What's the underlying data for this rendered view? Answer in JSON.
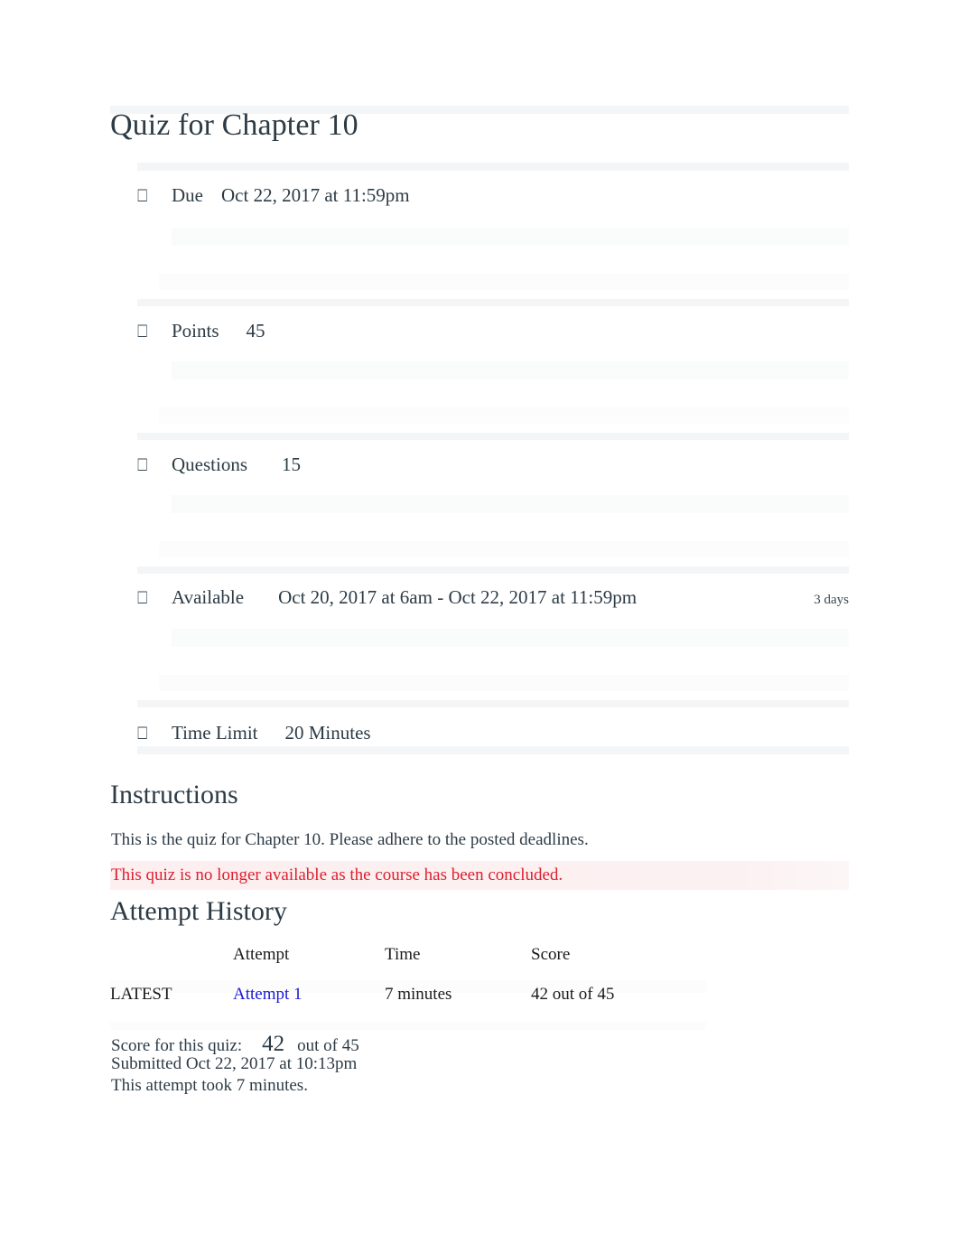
{
  "document": {
    "title": "Quiz for Chapter 10"
  },
  "meta": {
    "bullet_glyph": "⎕",
    "rows": [
      {
        "label": "Due",
        "value": "Oct 22, 2017 at 11:59pm",
        "trailing": ""
      },
      {
        "label": "Points",
        "value": "45",
        "trailing": ""
      },
      {
        "label": "Questions",
        "value": "15",
        "trailing": ""
      },
      {
        "label": "Available",
        "value": "Oct 20, 2017 at 6am - Oct 22, 2017 at 11:59pm",
        "trailing": "3 days"
      },
      {
        "label": "Time Limit",
        "value": "20 Minutes",
        "trailing": ""
      }
    ]
  },
  "instructions": {
    "heading": "Instructions",
    "body": "This is the quiz for Chapter 10. Please adhere to the posted deadlines.",
    "warning": "This quiz is no longer available as the course has been concluded."
  },
  "attempt_history": {
    "heading": "Attempt History",
    "columns": [
      "",
      "Attempt",
      "Time",
      "Score"
    ],
    "rows": [
      {
        "kept": "LATEST",
        "attempt": "Attempt 1",
        "time": "7 minutes",
        "score": "42 out of 45"
      }
    ]
  },
  "score_summary": {
    "label": "Score for this quiz:",
    "score": "42",
    "out_of": "out of 45",
    "submitted": "Submitted Oct 22, 2017 at 10:13pm",
    "duration": "This attempt took 7 minutes."
  },
  "colors": {
    "text": "#2d3b45",
    "link": "#1b1bd4",
    "warning": "#dc1f2e",
    "warning_background": "#fcf0f1",
    "band": "#f7f8f9"
  }
}
